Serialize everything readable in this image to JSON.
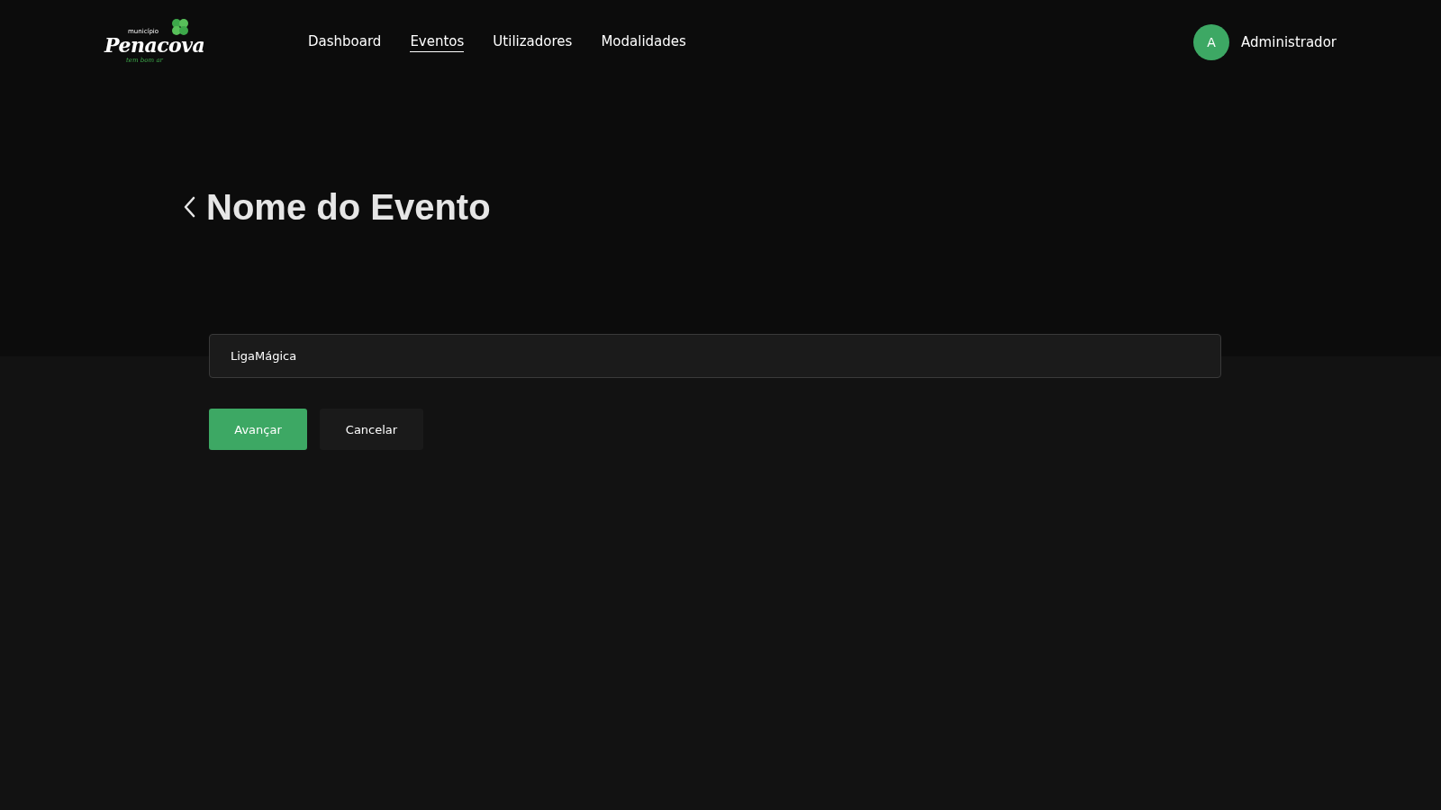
{
  "logo": {
    "small": "município",
    "name": "Penacova",
    "tagline": "tem bom ar"
  },
  "nav": [
    {
      "label": "Dashboard",
      "selected": false
    },
    {
      "label": "Eventos",
      "selected": true
    },
    {
      "label": "Utilizadores",
      "selected": false
    },
    {
      "label": "Modalidades",
      "selected": false
    }
  ],
  "user": {
    "initial": "A",
    "name": "Administrador"
  },
  "page_title": "Nome do Evento",
  "name_field": {
    "value": "LigaMágica"
  },
  "buttons": [
    {
      "label": "Avançar",
      "kind": "primary"
    },
    {
      "label": "Cancelar",
      "kind": "secondary"
    }
  ]
}
